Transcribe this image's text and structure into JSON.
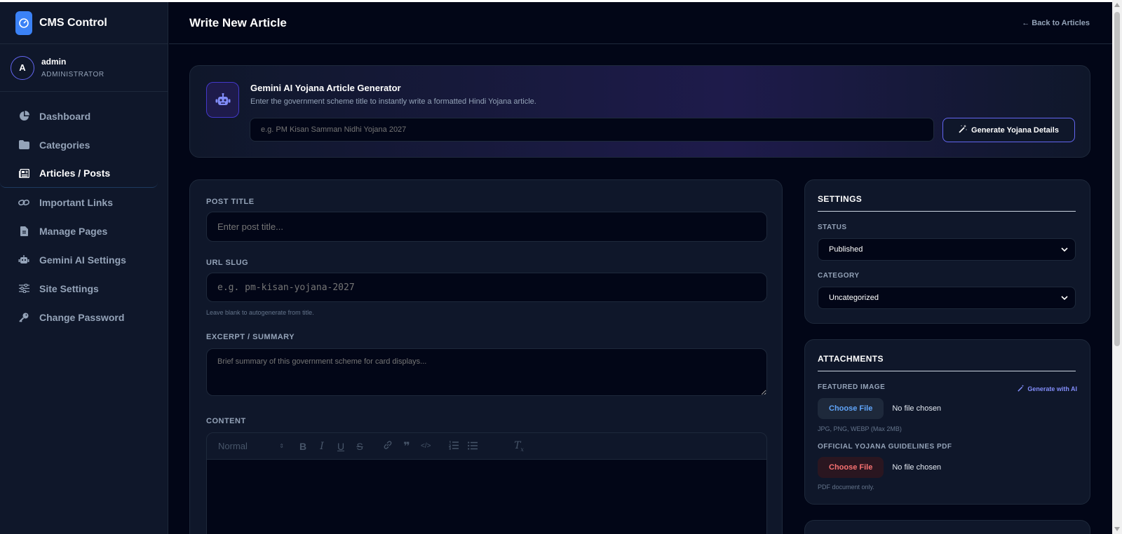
{
  "sidebar": {
    "brand": "CMS Control",
    "user": {
      "avatar_letter": "A",
      "name": "admin",
      "role": "ADMINISTRATOR"
    },
    "items": [
      {
        "label": "Dashboard",
        "icon": "pie-chart-icon"
      },
      {
        "label": "Categories",
        "icon": "folder-icon"
      },
      {
        "label": "Articles / Posts",
        "icon": "newspaper-icon"
      },
      {
        "label": "Important Links",
        "icon": "link-icon"
      },
      {
        "label": "Manage Pages",
        "icon": "file-icon"
      },
      {
        "label": "Gemini AI Settings",
        "icon": "robot-icon"
      },
      {
        "label": "Site Settings",
        "icon": "sliders-icon"
      },
      {
        "label": "Change Password",
        "icon": "key-icon"
      }
    ],
    "active_index": 2
  },
  "header": {
    "title": "Write New Article",
    "back_link": "Back to Articles"
  },
  "ai_generator": {
    "title": "Gemini AI Yojana Article Generator",
    "description": "Enter the government scheme title to instantly write a formatted Hindi Yojana article.",
    "input_placeholder": "e.g. PM Kisan Samman Nidhi Yojana 2027",
    "button_label": "Generate Yojana Details"
  },
  "form": {
    "post_title": {
      "label": "POST TITLE",
      "placeholder": "Enter post title..."
    },
    "url_slug": {
      "label": "URL SLUG",
      "placeholder": "e.g. pm-kisan-yojana-2027",
      "hint": "Leave blank to autogenerate from title."
    },
    "excerpt": {
      "label": "EXCERPT / SUMMARY",
      "placeholder": "Brief summary of this government scheme for card displays..."
    },
    "content": {
      "label": "CONTENT",
      "format_select": "Normal"
    }
  },
  "settings": {
    "title": "SETTINGS",
    "status_label": "STATUS",
    "status_value": "Published",
    "category_label": "CATEGORY",
    "category_value": "Uncategorized"
  },
  "attachments": {
    "title": "ATTACHMENTS",
    "featured_image_label": "FEATURED IMAGE",
    "generate_ai_label": "Generate with AI",
    "image_button": "Choose File",
    "image_status": "No file chosen",
    "image_hint": "JPG, PNG, WEBP (Max 2MB)",
    "pdf_label": "OFFICIAL YOJANA GUIDELINES PDF",
    "pdf_button": "Choose File",
    "pdf_status": "No file chosen",
    "pdf_hint": "PDF document only."
  },
  "colors": {
    "accent": "#6366f1",
    "brand_blue": "#3b82f6",
    "pdf_red": "#f87171",
    "background": "#020617",
    "card": "#0f172a"
  }
}
